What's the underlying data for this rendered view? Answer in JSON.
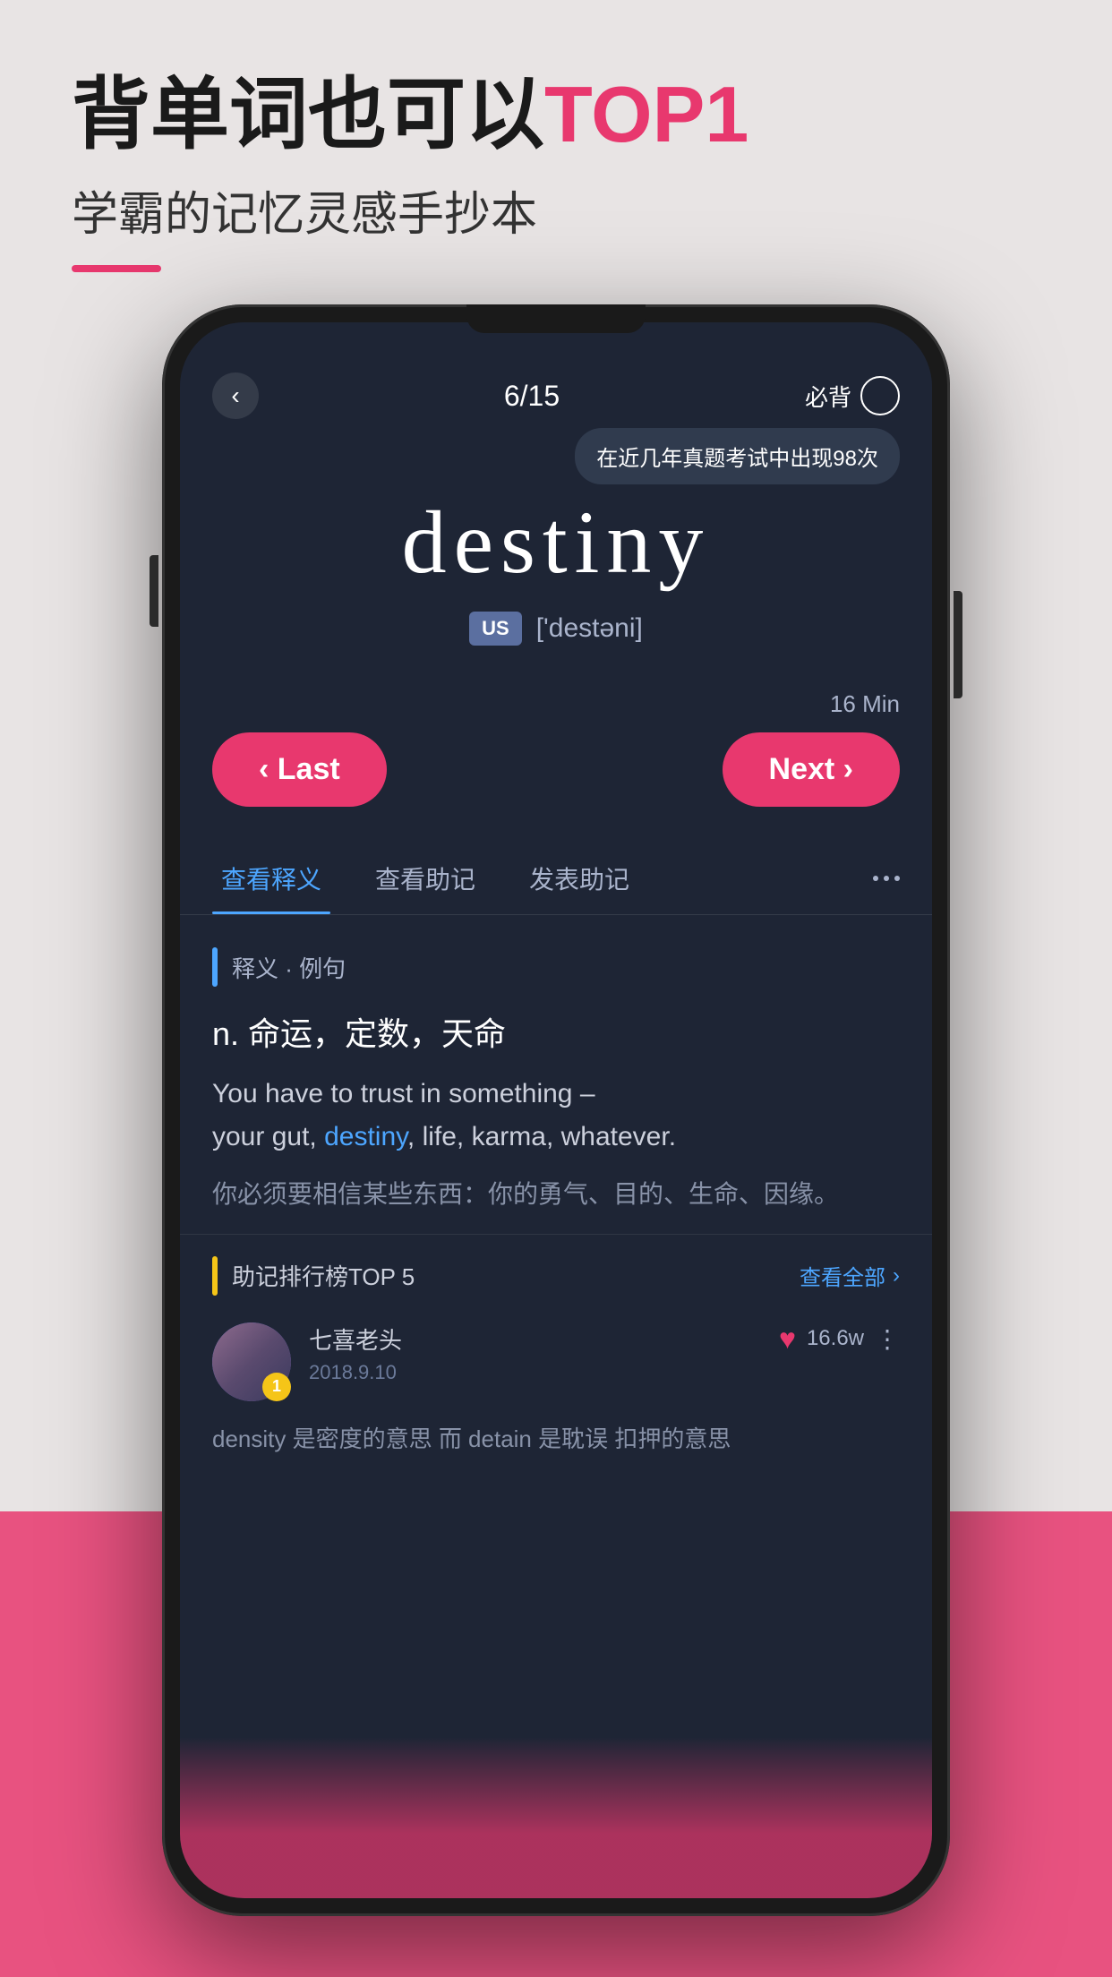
{
  "page": {
    "background_top": "#e8e4e4",
    "background_bottom": "#e8386e"
  },
  "header": {
    "title_prefix": "背单词也可以",
    "title_highlight": "TOP1",
    "subtitle": "学霸的记忆灵感手抄本",
    "accent_color": "#e8386e"
  },
  "phone": {
    "screen_bg": "#1e2535",
    "topbar": {
      "back_label": "‹",
      "progress": "6/15",
      "must_memorize_label": "必背"
    },
    "tooltip": {
      "text": "在近几年真题考试中出现98次"
    },
    "word": {
      "text": "destiny",
      "lang_badge": "US",
      "phonetic": "['destəni]"
    },
    "timer": {
      "label": "16 Min"
    },
    "nav": {
      "last_label": "‹ Last",
      "next_label": "Next ›"
    },
    "tabs": [
      {
        "label": "查看释义",
        "active": true
      },
      {
        "label": "查看助记",
        "active": false
      },
      {
        "label": "发表助记",
        "active": false
      }
    ],
    "definition_section": {
      "label": "释义 · 例句",
      "pos": "n.  命运，定数，天命",
      "example_en_parts": [
        {
          "text": "You have to trust in something –",
          "highlight": false
        },
        {
          "text": "your gut, ",
          "highlight": false
        },
        {
          "text": "destiny",
          "highlight": true
        },
        {
          "text": ", life, karma, whatever.",
          "highlight": false
        }
      ],
      "example_cn": "你必须要相信某些东西：你的勇气、目的、生命、因缘。"
    },
    "mnemonic_section": {
      "title": "助记排行榜TOP 5",
      "view_all": "查看全部",
      "user": {
        "name": "七喜老头",
        "date": "2018.9.10",
        "badge": "1",
        "like_count": "16.6w",
        "mnemonic_preview": "density 是密度的意思  而 detain 是耽误 扣押的意思"
      }
    }
  }
}
